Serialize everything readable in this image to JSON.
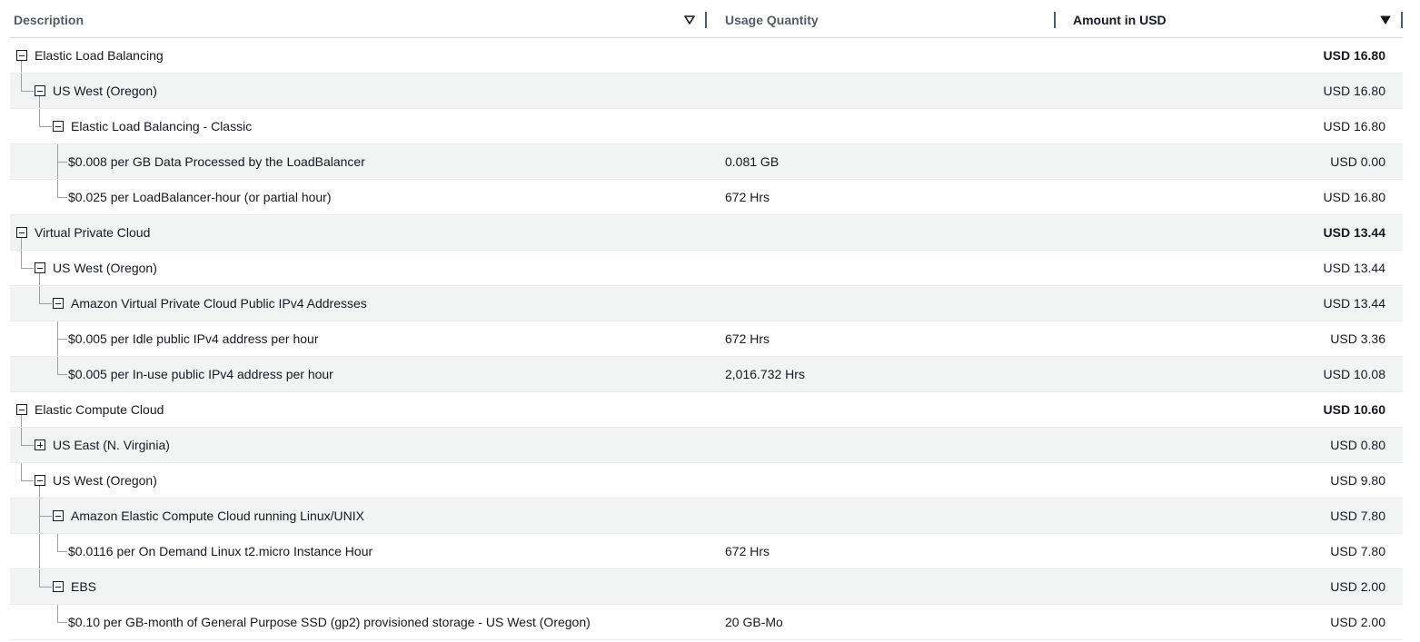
{
  "header": {
    "description": "Description",
    "usage_quantity": "Usage Quantity",
    "amount": "Amount in USD"
  },
  "rows": [
    {
      "level": 0,
      "toggle": "minus",
      "description": "Elastic Load Balancing",
      "usage": "",
      "amount": "USD 16.80",
      "bold": true
    },
    {
      "level": 1,
      "toggle": "minus",
      "description": "US West (Oregon)",
      "usage": "",
      "amount": "USD 16.80",
      "bold": false
    },
    {
      "level": 2,
      "toggle": "minus",
      "description": "Elastic Load Balancing - Classic",
      "usage": "",
      "amount": "USD 16.80",
      "bold": false
    },
    {
      "level": 3,
      "toggle": "none",
      "description": "$0.008 per GB Data Processed by the LoadBalancer",
      "usage": "0.081 GB",
      "amount": "USD 0.00",
      "bold": false
    },
    {
      "level": 3,
      "toggle": "none",
      "description": "$0.025 per LoadBalancer-hour (or partial hour)",
      "usage": "672 Hrs",
      "amount": "USD 16.80",
      "bold": false
    },
    {
      "level": 0,
      "toggle": "minus",
      "description": "Virtual Private Cloud",
      "usage": "",
      "amount": "USD 13.44",
      "bold": true
    },
    {
      "level": 1,
      "toggle": "minus",
      "description": "US West (Oregon)",
      "usage": "",
      "amount": "USD 13.44",
      "bold": false
    },
    {
      "level": 2,
      "toggle": "minus",
      "description": "Amazon Virtual Private Cloud Public IPv4 Addresses",
      "usage": "",
      "amount": "USD 13.44",
      "bold": false
    },
    {
      "level": 3,
      "toggle": "none",
      "description": "$0.005 per Idle public IPv4 address per hour",
      "usage": "672 Hrs",
      "amount": "USD 3.36",
      "bold": false
    },
    {
      "level": 3,
      "toggle": "none",
      "description": "$0.005 per In-use public IPv4 address per hour",
      "usage": "2,016.732 Hrs",
      "amount": "USD 10.08",
      "bold": false
    },
    {
      "level": 0,
      "toggle": "minus",
      "description": "Elastic Compute Cloud",
      "usage": "",
      "amount": "USD 10.60",
      "bold": true
    },
    {
      "level": 1,
      "toggle": "plus",
      "description": "US East (N. Virginia)",
      "usage": "",
      "amount": "USD 0.80",
      "bold": false
    },
    {
      "level": 1,
      "toggle": "minus",
      "description": "US West (Oregon)",
      "usage": "",
      "amount": "USD 9.80",
      "bold": false
    },
    {
      "level": 2,
      "toggle": "minus",
      "description": "Amazon Elastic Compute Cloud running Linux/UNIX",
      "usage": "",
      "amount": "USD 7.80",
      "bold": false
    },
    {
      "level": 3,
      "toggle": "none",
      "description": "$0.0116 per On Demand Linux t2.micro Instance Hour",
      "usage": "672 Hrs",
      "amount": "USD 7.80",
      "bold": false
    },
    {
      "level": 2,
      "toggle": "minus",
      "description": "EBS",
      "usage": "",
      "amount": "USD 2.00",
      "bold": false
    },
    {
      "level": 3,
      "toggle": "none",
      "description": "$0.10 per GB-month of General Purpose SSD (gp2) provisioned storage - US West (Oregon)",
      "usage": "20 GB-Mo",
      "amount": "USD 2.00",
      "bold": false
    }
  ]
}
